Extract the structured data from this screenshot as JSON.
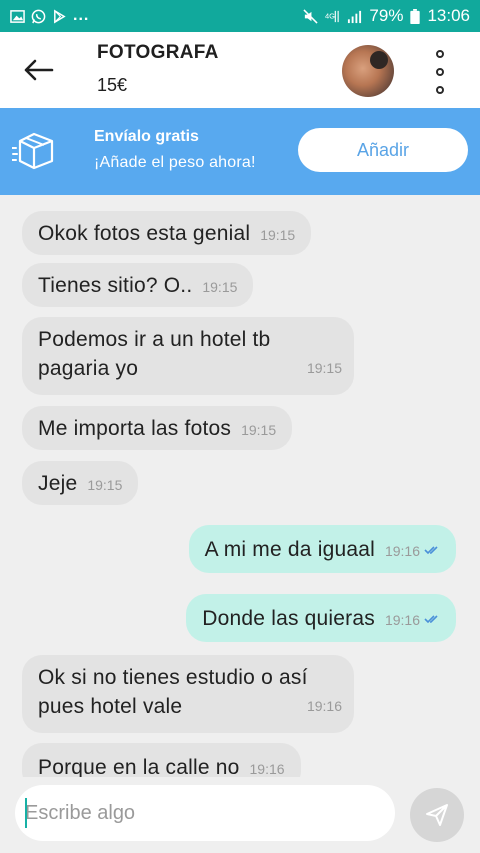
{
  "status_bar": {
    "battery": "79%",
    "time": "13:06",
    "more": "...",
    "icons": [
      "image-icon",
      "whatsapp-icon",
      "play-store-icon",
      "mute-icon",
      "4g-icon",
      "signal-icon",
      "battery-icon"
    ]
  },
  "header": {
    "title": "FOTOGRAFA",
    "price": "15€",
    "icons": [
      "back-arrow-icon",
      "avatar",
      "more-vertical-icon"
    ]
  },
  "promo": {
    "title": "Envíalo gratis",
    "subtitle": "¡Añade el peso ahora!",
    "button": "Añadir",
    "icon": "shipping-box-icon"
  },
  "messages": [
    {
      "dir": "in",
      "text": "Okok fotos esta genial",
      "time": "19:15"
    },
    {
      "dir": "in",
      "text": "Tienes sitio? O..",
      "time": "19:15"
    },
    {
      "dir": "in",
      "text": "Podemos ir a un hotel tb pagaria yo",
      "time": "19:15"
    },
    {
      "dir": "in",
      "text": "Me importa las fotos",
      "time": "19:15"
    },
    {
      "dir": "in",
      "text": "Jeje",
      "time": "19:15"
    },
    {
      "dir": "out",
      "text": "A mi me da iguaal",
      "time": "19:16",
      "read": true
    },
    {
      "dir": "out",
      "text": "Donde las quieras",
      "time": "19:16",
      "read": true
    },
    {
      "dir": "in",
      "text": "Ok  si no tienes estudio o así pues hotel vale",
      "time": "19:16"
    },
    {
      "dir": "in",
      "text": "Porque en la calle no",
      "time": "19:16"
    }
  ],
  "composer": {
    "placeholder": "Escribe algo",
    "send_icon": "send-icon"
  },
  "colors": {
    "status_bar": "#11a99c",
    "promo": "#58a9ef",
    "incoming": "#e3e3e3",
    "outgoing": "#c2f1e8",
    "read_ticks": "#4a90d9",
    "caret": "#17b1a6"
  }
}
